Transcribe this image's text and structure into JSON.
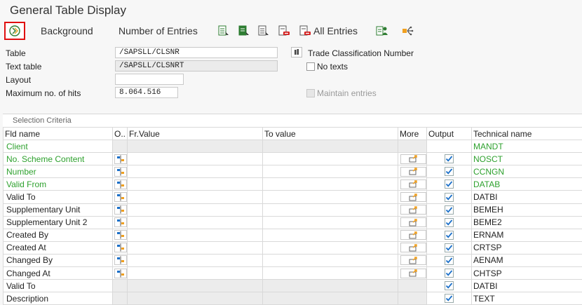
{
  "window": {
    "title": "General Table Display"
  },
  "toolbar": {
    "background_label": "Background",
    "number_of_entries_label": "Number of Entries",
    "all_entries_label": "All Entries",
    "execute_icon": "execute-icon"
  },
  "form": {
    "table_label": "Table",
    "table_value": "/SAPSLL/CLSNR",
    "table_description": "Trade Classification Number",
    "text_table_label": "Text table",
    "text_table_value": "/SAPSLL/CLSNRT",
    "no_texts_label": "No texts",
    "no_texts_checked": false,
    "layout_label": "Layout",
    "layout_value": "",
    "max_hits_label": "Maximum no. of hits",
    "max_hits_value": "8.064.516",
    "maintain_entries_label": "Maintain entries",
    "maintain_entries_checked": false
  },
  "selection": {
    "section_title": "Selection Criteria",
    "columns": {
      "field_name": "Fld name",
      "option": "O..",
      "from_value": "Fr.Value",
      "to_value": "To value",
      "more": "More",
      "output": "Output",
      "technical_name": "Technical name"
    },
    "rows": [
      {
        "name": "Client",
        "tech": "MANDT",
        "key": true,
        "selectable": false,
        "output": false
      },
      {
        "name": "No. Scheme Content",
        "tech": "NOSCT",
        "key": true,
        "selectable": true,
        "output": true
      },
      {
        "name": "Number",
        "tech": "CCNGN",
        "key": true,
        "selectable": true,
        "output": true
      },
      {
        "name": "Valid From",
        "tech": "DATAB",
        "key": true,
        "selectable": true,
        "output": true
      },
      {
        "name": "Valid To",
        "tech": "DATBI",
        "key": false,
        "selectable": true,
        "output": true
      },
      {
        "name": "Supplementary Unit",
        "tech": "BEMEH",
        "key": false,
        "selectable": true,
        "output": true
      },
      {
        "name": "Supplementary Unit 2",
        "tech": "BEME2",
        "key": false,
        "selectable": true,
        "output": true
      },
      {
        "name": "Created By",
        "tech": "ERNAM",
        "key": false,
        "selectable": true,
        "output": true
      },
      {
        "name": "Created At",
        "tech": "CRTSP",
        "key": false,
        "selectable": true,
        "output": true
      },
      {
        "name": "Changed By",
        "tech": "AENAM",
        "key": false,
        "selectable": true,
        "output": true
      },
      {
        "name": "Changed At",
        "tech": "CHTSP",
        "key": false,
        "selectable": true,
        "output": true
      },
      {
        "name": "Valid To",
        "tech": "DATBI",
        "key": false,
        "selectable": false,
        "output": true
      },
      {
        "name": "Description",
        "tech": "TEXT",
        "key": false,
        "selectable": false,
        "output": true
      }
    ]
  },
  "colors": {
    "key_field": "#2ea12e",
    "highlight_border": "#e01010",
    "check_blue": "#1a6fc9",
    "more_arrow": "#f0a020"
  }
}
